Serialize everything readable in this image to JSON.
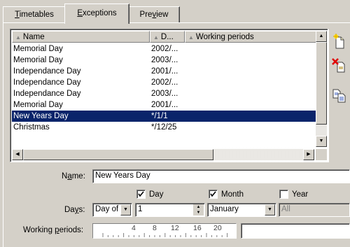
{
  "tabs": [
    {
      "label_html": "<span class='u'>T</span>imetables",
      "label": "Timetables"
    },
    {
      "label_html": "<span class='u'>E</span>xceptions",
      "label": "Exceptions"
    },
    {
      "label_html": "Pre<span class='u'>v</span>iew",
      "label": "Preview"
    }
  ],
  "active_tab": "Exceptions",
  "list": {
    "columns": [
      "Name",
      "D...",
      "Working periods"
    ],
    "rows": [
      {
        "name": "Memorial Day",
        "date": "2002/..."
      },
      {
        "name": "Memorial Day",
        "date": "2003/..."
      },
      {
        "name": "Independance Day",
        "date": "2001/..."
      },
      {
        "name": "Independance Day",
        "date": "2002/..."
      },
      {
        "name": "Independance Day",
        "date": "2003/..."
      },
      {
        "name": "Memorial Day",
        "date": "2001/..."
      },
      {
        "name": "New Years Day",
        "date": "*/1/1",
        "selected": true
      },
      {
        "name": "Christmas",
        "date": "*/12/25"
      }
    ]
  },
  "toolbar": [
    {
      "name": "new-exception-button",
      "icon": "new-document-icon"
    },
    {
      "name": "delete-exception-button",
      "icon": "delete-icon"
    },
    {
      "name": "duplicate-exception-button",
      "icon": "duplicate-icon"
    }
  ],
  "form": {
    "name_label": "Name:",
    "name_value": "New Years Day",
    "day_check_label": "Day",
    "month_check_label": "Month",
    "year_check_label": "Year",
    "day_checked": true,
    "month_checked": true,
    "year_checked": false,
    "days_label": "Days:",
    "days_type_value": "Day of",
    "day_number_value": "1",
    "month_value": "January",
    "year_value": "All",
    "working_periods_label": "Working periods:",
    "ruler_ticks": [
      "4",
      "8",
      "12",
      "16",
      "20"
    ]
  },
  "colors": {
    "selection": "#0a246a",
    "face": "#d4d0c8"
  }
}
